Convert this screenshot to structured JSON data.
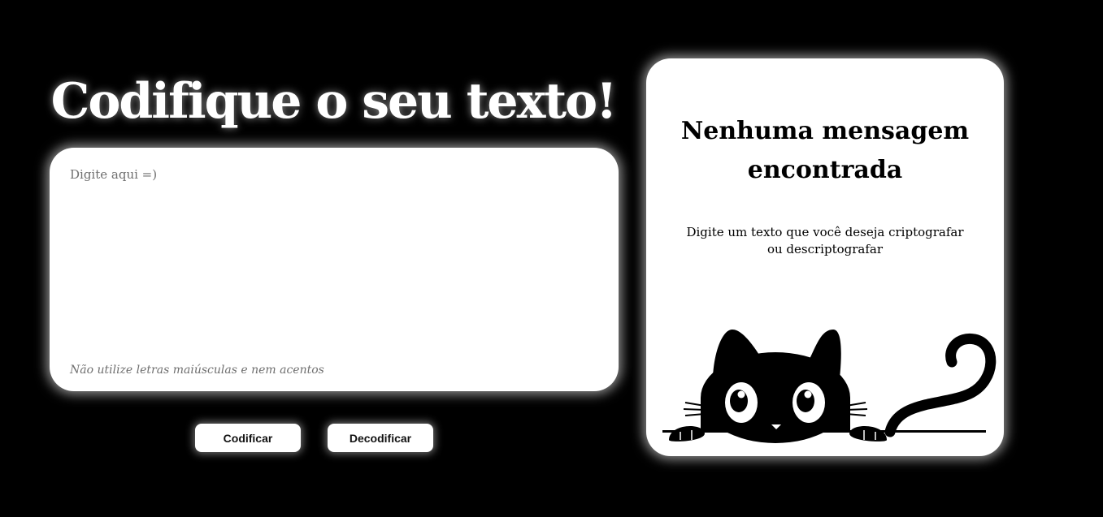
{
  "main": {
    "title": "Codifique o seu texto!",
    "input": {
      "placeholder": "Digite aqui =)",
      "value": ""
    },
    "hint": "Não utilize letras maiúsculas e nem acentos",
    "buttons": {
      "encode_label": "Codificar",
      "decode_label": "Decodificar"
    }
  },
  "output": {
    "title": "Nenhuma mensagem encontrada",
    "message": "Digite um texto que você deseja criptografar ou descriptografar",
    "illustration": "peeking-cat-icon"
  },
  "colors": {
    "background": "#000000",
    "card": "#ffffff",
    "text": "#000000",
    "muted": "#6f6f6f"
  }
}
